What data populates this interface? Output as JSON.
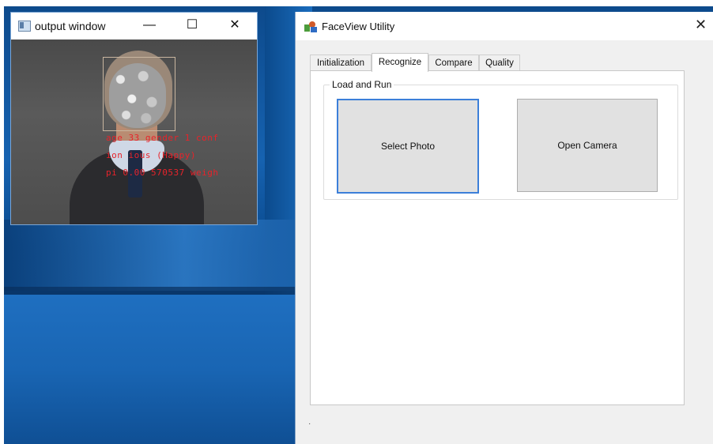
{
  "output_window": {
    "title": "output window",
    "controls": {
      "minimize": "—",
      "maximize": "☐",
      "close": "✕"
    },
    "detection_lines": [
      "age 33 gender 1 conf",
      "ion ious (Happy)",
      "pi 0.00 570537 weigh"
    ]
  },
  "faceview": {
    "title": "FaceView Utility",
    "close": "✕",
    "tabs": [
      {
        "label": "Initialization",
        "active": false
      },
      {
        "label": "Recognize",
        "active": true
      },
      {
        "label": "Compare",
        "active": false
      },
      {
        "label": "Quality",
        "active": false
      }
    ],
    "group_title": "Load and Run",
    "buttons": {
      "select_photo": "Select Photo",
      "open_camera": "Open Camera"
    },
    "status": "·"
  },
  "colors": {
    "accent_focus": "#3c7fd9",
    "detection_text": "#e8232a",
    "desktop_blue": "#1662b0"
  }
}
